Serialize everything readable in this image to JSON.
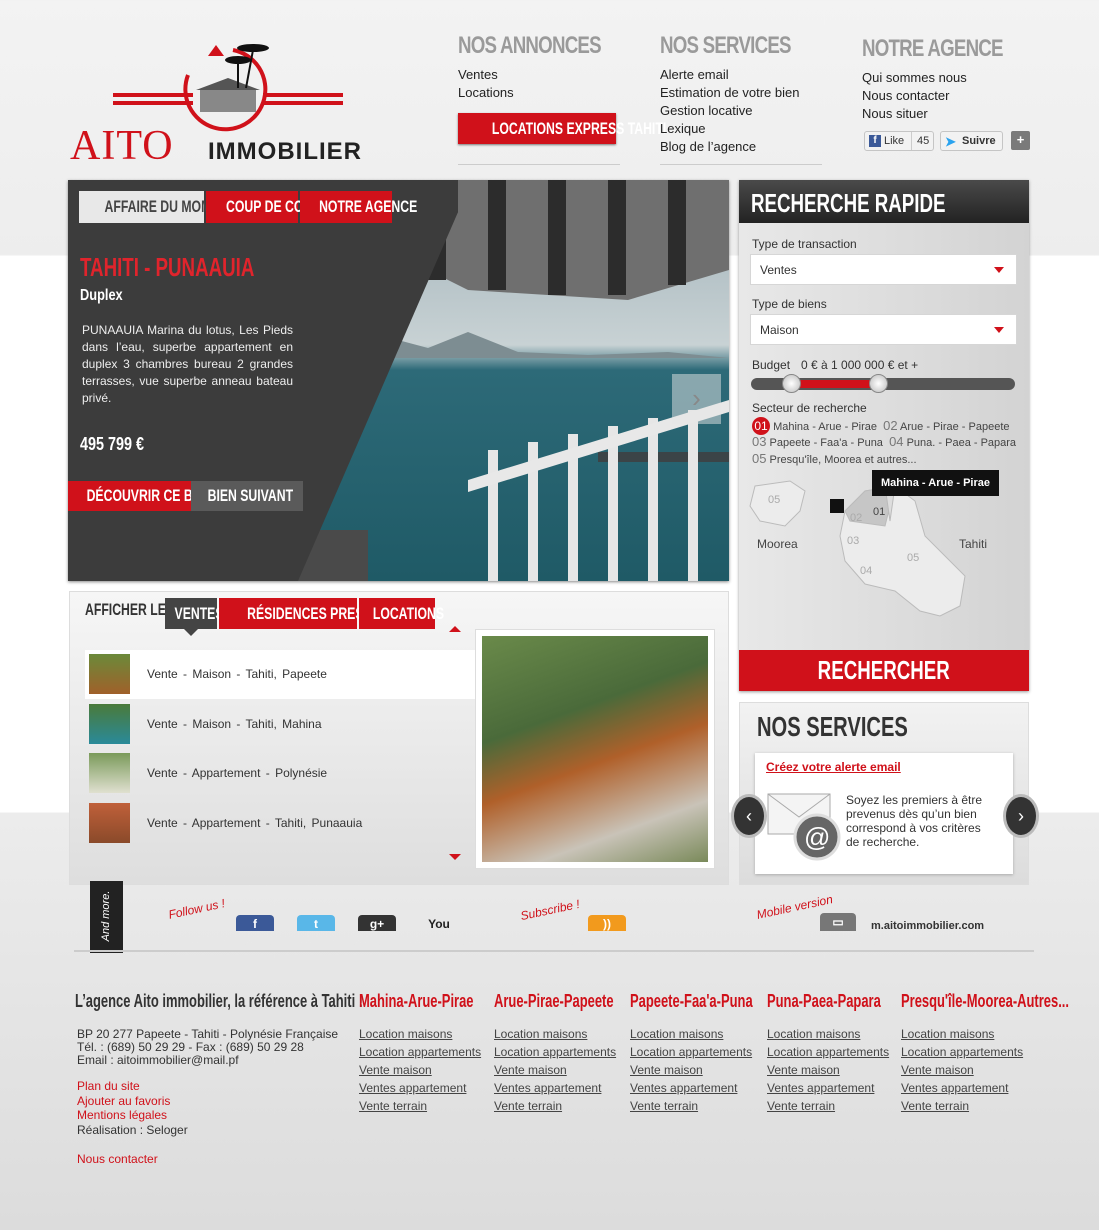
{
  "brand": {
    "logo_text_main": "AITO",
    "logo_text_sub": "IMMOBILIER",
    "primary": "#d0111a",
    "dark": "#222222"
  },
  "nav": {
    "annonces": {
      "title": "NOS ANNONCES",
      "items": [
        "Ventes",
        "Locations"
      ],
      "cta": "LOCATIONS EXPRESS TAHITI"
    },
    "services": {
      "title": "NOS SERVICES",
      "items": [
        "Alerte email",
        "Estimation de votre bien",
        "Gestion locative",
        "Lexique",
        "Blog de l’agence"
      ]
    },
    "agence": {
      "title": "NOTRE AGENCE",
      "items": [
        "Qui sommes nous",
        "Nous contacter",
        "Nous situer"
      ]
    },
    "social": {
      "like": "Like",
      "like_count": "45",
      "follow": "Suivre"
    }
  },
  "hero": {
    "tabs": [
      "AFFAIRE DU MOMENT",
      "COUP DE COEUR",
      "NOTRE AGENCE"
    ],
    "title": "TAHITI - PUNAAUIA",
    "subtitle": "Duplex",
    "description": "PUNAAUIA Marina du lotus, Les Pieds dans l’eau, superbe appartement en duplex 3 chambres bureau 2 grandes terrasses, vue superbe anneau bateau privé.",
    "price": "495 799  €",
    "btn_discover": "DÉCOUVRIR CE BIEN",
    "btn_next": "BIEN SUIVANT"
  },
  "listing": {
    "label": "AFFICHER LES",
    "tabs": [
      "VENTES",
      "RÉSIDENCES PRESTIGE",
      "LOCATIONS"
    ],
    "rows": [
      "Vente  -  Maison  -  Tahiti, Papeete",
      "Vente  -  Maison  -  Tahiti, Mahina",
      "Vente  -  Appartement  -  Polynésie",
      "Vente  -  Appartement  -  Tahiti, Punaauia"
    ]
  },
  "search": {
    "title": "RECHERCHE RAPIDE",
    "transaction_label": "Type de transaction",
    "transaction_value": "Ventes",
    "type_label": "Type de biens",
    "type_value": "Maison",
    "budget_label": "Budget",
    "budget_value": "0 € à 1 000 000 € et +",
    "budget_range_fraction": [
      0.15,
      0.48
    ],
    "sector_label": "Secteur de recherche",
    "sectors": [
      {
        "num": "01",
        "name": "Mahina - Arue - Pirae"
      },
      {
        "num": "02",
        "name": "Arue - Pirae - Papeete"
      },
      {
        "num": "03",
        "name": "Papeete - Faa'a - Puna"
      },
      {
        "num": "04",
        "name": "Puna. - Paea - Papara"
      },
      {
        "num": "05",
        "name": "Presqu'île, Moorea et autres..."
      }
    ],
    "map_labels": {
      "moorea": "Moorea",
      "tahiti": "Tahiti",
      "z05a": "05",
      "z01": "01",
      "z02": "02",
      "z03": "03",
      "z04": "04",
      "z05b": "05"
    },
    "tooltip": "Mahina - Arue - Pirae",
    "button": "RECHERCHER"
  },
  "services_box": {
    "title": "NOS SERVICES",
    "link": "Créez votre alerte email",
    "text": "Soyez les premiers à être prevenus dès qu’un bien correspond à vos critères de recherche."
  },
  "strip": {
    "and_more": "And more.",
    "follow": "Follow us !",
    "subscribe": "Subscribe !",
    "mobile": "Mobile version",
    "youtube": "You",
    "mobile_url": "m.aitoimmobilier.com"
  },
  "footer": {
    "title": "L’agence Aito immobilier, la référence à Tahiti !",
    "address": [
      "BP 20 277 Papeete - Tahiti - Polynésie Française",
      "Tél. : (689) 50 29 29 - Fax : (689) 50 29 28",
      "Email : aitoimmobilier@mail.pf"
    ],
    "links": [
      "Plan du site",
      "Ajouter au favoris",
      "Mentions légales"
    ],
    "credit": "Réalisation : Seloger",
    "contact": "Nous contacter",
    "columns": [
      {
        "title": "Mahina-Arue-Pirae",
        "items": [
          "Location maisons",
          "Location appartements",
          "Vente maison",
          "Ventes appartement",
          "Vente terrain"
        ]
      },
      {
        "title": "Arue-Pirae-Papeete",
        "items": [
          "Location maisons",
          "Location appartements",
          "Vente maison",
          "Ventes appartement",
          "Vente terrain"
        ]
      },
      {
        "title": "Papeete-Faa'a-Puna",
        "items": [
          "Location maisons",
          "Location appartements",
          "Vente maison",
          "Ventes appartement",
          "Vente terrain"
        ]
      },
      {
        "title": "Puna-Paea-Papara",
        "items": [
          "Location maisons",
          "Location appartements",
          "Vente maison",
          "Ventes appartement",
          "Vente terrain"
        ]
      },
      {
        "title": "Presqu'île-Moorea-Autres...",
        "items": [
          "Location maisons",
          "Location appartements",
          "Vente maison",
          "Ventes appartement",
          "Vente terrain"
        ]
      }
    ]
  }
}
